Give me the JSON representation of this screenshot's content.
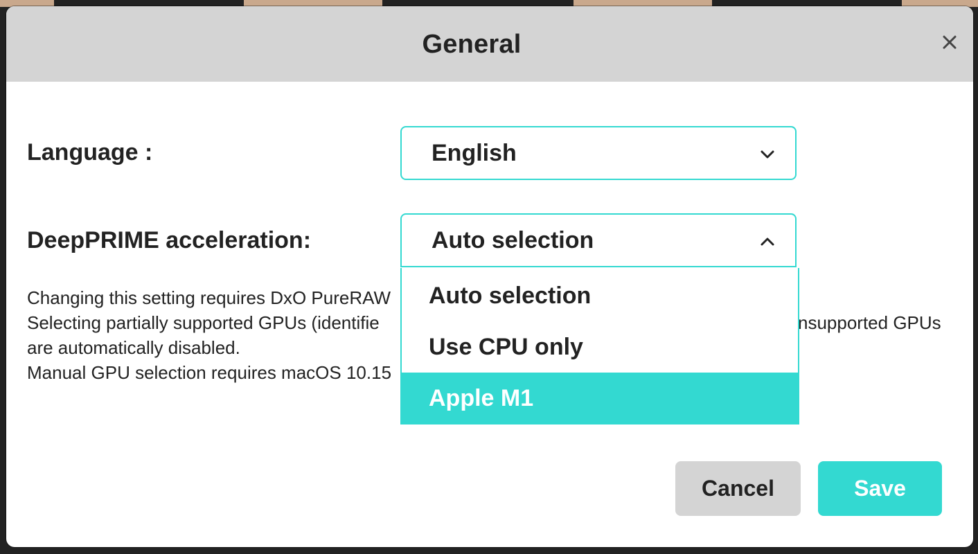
{
  "dialog": {
    "title": "General",
    "close_icon": "close-icon"
  },
  "language": {
    "label": "Language :",
    "value": "English",
    "icon": "chevron-down-icon"
  },
  "deepprime": {
    "label": "DeepPRIME acceleration:",
    "value": "Auto selection",
    "icon": "chevron-up-icon",
    "options": [
      {
        "label": "Auto selection",
        "selected": false
      },
      {
        "label": "Use CPU only",
        "selected": false
      },
      {
        "label": "Apple M1",
        "selected": true
      }
    ]
  },
  "help": {
    "lines": [
      "Changing this setting requires DxO PureRAW",
      "Selecting partially supported GPUs (identifie",
      "are automatically disabled.",
      "Manual GPU selection requires macOS 10.15"
    ],
    "line2_suffix": "nsupported GPUs"
  },
  "buttons": {
    "cancel": "Cancel",
    "save": "Save"
  },
  "colors": {
    "accent": "#33d9d1",
    "header_bg": "#d4d4d4",
    "text": "#222222"
  }
}
